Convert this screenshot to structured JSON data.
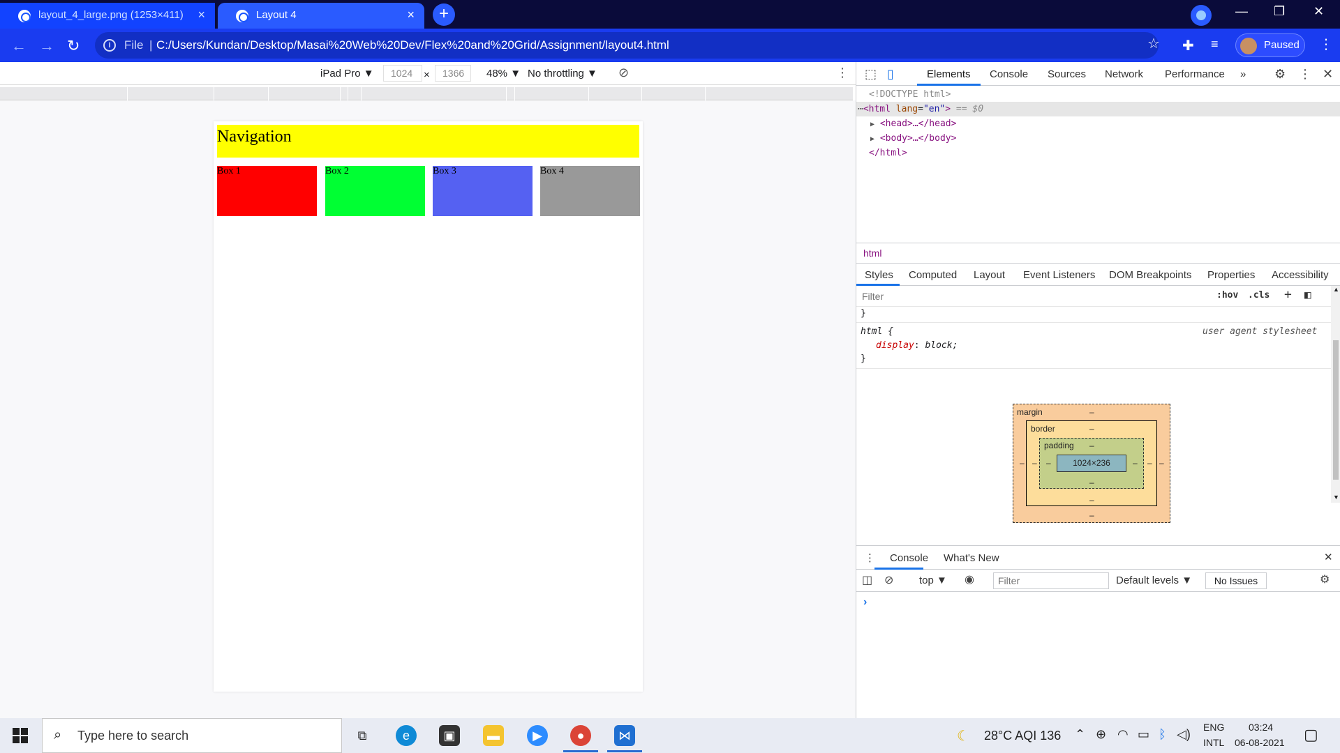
{
  "browser": {
    "tabs": [
      {
        "title": "layout_4_large.png (1253×411)",
        "close": "×"
      },
      {
        "title": "Layout 4",
        "close": "×"
      }
    ],
    "new_tab": "+",
    "window_controls": {
      "minimize": "—",
      "restore": "❐",
      "close": "✕"
    },
    "nav": {
      "back": "←",
      "forward": "→",
      "reload": "↻"
    },
    "omnibox": {
      "scheme_label": "File",
      "separator": "|",
      "url": "C:/Users/Kundan/Desktop/Masai%20Web%20Dev/Flex%20and%20Grid/Assignment/layout4.html"
    },
    "profile": {
      "label": "Paused"
    },
    "icons": {
      "star": "star-icon",
      "extensions": "puzzle-icon",
      "media": "media-icon",
      "menu": "kebab-icon"
    }
  },
  "device_toolbar": {
    "device": "iPad Pro ▼",
    "width": "1024",
    "times": "×",
    "height": "1366",
    "zoom": "48% ▼",
    "throttling": "No throttling ▼"
  },
  "page": {
    "nav_label": "Navigation",
    "boxes": [
      "Box 1",
      "Box 2",
      "Box 3",
      "Box 4"
    ],
    "colors": {
      "nav": "#ffff00",
      "box1": "#ff0000",
      "box2": "#00ff33",
      "box3": "#5561f2",
      "box4": "#999999"
    }
  },
  "devtools": {
    "tabs": [
      "Elements",
      "Console",
      "Sources",
      "Network",
      "Performance"
    ],
    "more": "»",
    "dom": {
      "doctype": "<!DOCTYPE html>",
      "html_open_tag": "<html",
      "html_attr": "lang",
      "html_attr_val": "\"en\"",
      "html_open_end": ">",
      "selected_marker": "== $0",
      "head": "<head>…</head>",
      "body": "<body>…</body>",
      "html_close": "</html>"
    },
    "breadcrumb": "html",
    "sub_tabs": [
      "Styles",
      "Computed",
      "Layout",
      "Event Listeners",
      "DOM Breakpoints",
      "Properties",
      "Accessibility"
    ],
    "styles_filter_placeholder": "Filter",
    "hov": ":hov",
    "cls": ".cls",
    "add_rule": "+",
    "styles": {
      "close_brace_prev": "}",
      "selector": "html {",
      "origin": "user agent stylesheet",
      "prop": "display",
      "value": "block;",
      "close_brace": "}"
    },
    "box_model": {
      "margin_label": "margin",
      "border_label": "border",
      "padding_label": "padding",
      "content": "1024×236",
      "dash": "–"
    },
    "drawer": {
      "tabs": [
        "Console",
        "What's New"
      ],
      "context": "top ▼",
      "filter_placeholder": "Filter",
      "levels": "Default levels ▼",
      "issues": "No Issues",
      "prompt": "›"
    }
  },
  "taskbar": {
    "search_placeholder": "Type here to search",
    "weather": "28°C  AQI 136",
    "lang_top": "ENG",
    "lang_bottom": "INTL",
    "time": "03:24",
    "date": "06-08-2021"
  }
}
